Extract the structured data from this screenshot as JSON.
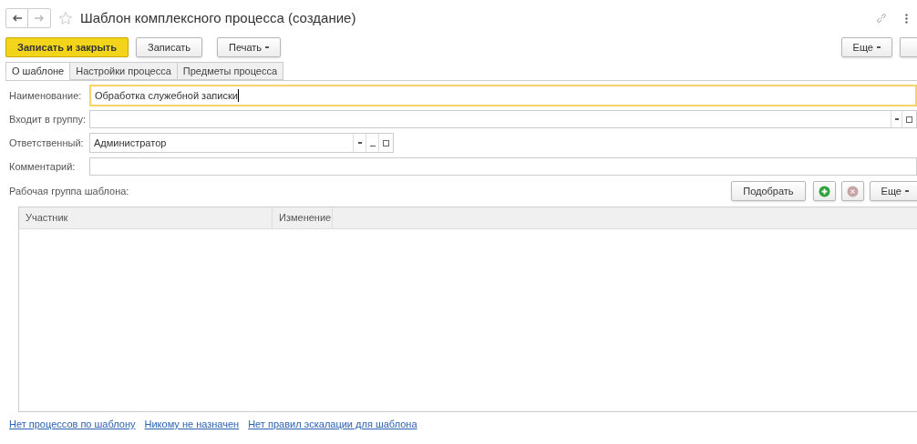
{
  "window": {
    "title": "Шаблон комплексного процесса (создание)"
  },
  "toolbar": {
    "buttons": [
      {
        "label": "Записать и закрыть",
        "kind": "primary"
      },
      {
        "label": "Записать",
        "kind": "plain"
      },
      {
        "label": "Печать",
        "kind": "menu"
      }
    ],
    "more": "Еще"
  },
  "tabs": [
    {
      "label": "О шаблоне",
      "selected": true
    },
    {
      "label": "Настройки процесса",
      "selected": false
    },
    {
      "label": "Предметы процесса",
      "selected": false
    }
  ],
  "fields": [
    {
      "label": "Наименование:",
      "value": "Обработка служебной записки",
      "kind": "focused"
    },
    {
      "label": "Входит в группу:",
      "kind": "choice"
    },
    {
      "label": "Ответственный:",
      "value": "Администратор",
      "kind": "short"
    },
    {
      "label": "Комментарий:",
      "kind": "plain"
    }
  ],
  "work_group": {
    "label": "Рабочая группа шаблона:",
    "pick": "Подобрать",
    "more": "Еще",
    "columns": [
      "Участник",
      "Изменение"
    ]
  },
  "links": [
    "Нет процессов по шаблону",
    "Никому не назначен",
    "Нет правил эскалации для шаблона"
  ]
}
